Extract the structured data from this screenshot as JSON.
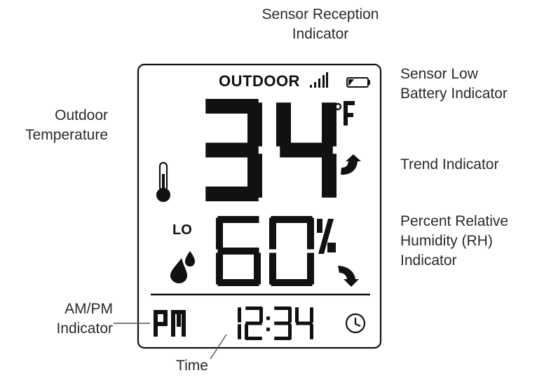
{
  "callouts": {
    "sensor_reception": [
      "Sensor Reception",
      "Indicator"
    ],
    "sensor_low_battery": [
      "Sensor Low",
      "Battery Indicator"
    ],
    "outdoor_temperature": [
      "Outdoor",
      "Temperature"
    ],
    "trend": [
      "Trend Indicator"
    ],
    "humidity": [
      "Percent Relative",
      "Humidity (RH)",
      "Indicator"
    ],
    "ampm": [
      "AM/PM",
      "Indicator"
    ],
    "time": [
      "Time"
    ]
  },
  "display": {
    "outdoor_label": "OUTDOOR",
    "temperature": "34",
    "temp_unit": "°F",
    "temp_trend": "rising",
    "humidity_lo": "LO",
    "humidity": "60",
    "humidity_unit": "%",
    "humidity_trend": "falling",
    "ampm": "PM",
    "time": "12:34"
  },
  "icons": [
    "signal-bars-icon",
    "low-battery-icon",
    "thermometer-icon",
    "water-drops-icon",
    "trend-up-arrow-icon",
    "trend-down-arrow-icon",
    "clock-icon"
  ],
  "colors": {
    "segments": "#111111",
    "frame": "#111111",
    "callout_text": "#2a2a2a",
    "leader_line": "#555555"
  }
}
